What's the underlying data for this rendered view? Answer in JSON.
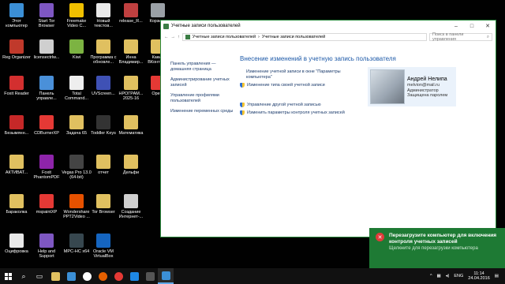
{
  "desktop": {
    "icons": [
      {
        "label": "Этот компьютер",
        "color": "#3b8fd6",
        "icon": "computer-icon"
      },
      {
        "label": "Start Tor Browser",
        "color": "#7e57c2",
        "icon": "tor-icon"
      },
      {
        "label": "Freemake Video C...",
        "color": "#f0c000",
        "icon": "freemake-icon"
      },
      {
        "label": "Новый текстов...",
        "color": "#e8e8e8",
        "icon": "text-file-icon"
      },
      {
        "label": "release_R...",
        "color": "#c04040",
        "icon": "archive-icon"
      },
      {
        "label": "Корзина",
        "color": "#9aa0a6",
        "icon": "recycle-bin-icon"
      },
      {
        "label": "Reg Organizer",
        "color": "#c0392b",
        "icon": "regorganizer-icon"
      },
      {
        "label": "licensectrlw...",
        "color": "#cfcfcf",
        "icon": "file-icon"
      },
      {
        "label": "Kiwi",
        "color": "#7cb342",
        "icon": "kiwi-icon"
      },
      {
        "label": "Программа с обновле...",
        "color": "#e0c060",
        "icon": "folder-icon"
      },
      {
        "label": "Инна Владимир...",
        "color": "#e0c060",
        "icon": "folder-icon"
      },
      {
        "label": "Какие ВКонтак...",
        "color": "#e0c060",
        "icon": "folder-icon"
      },
      {
        "label": "Foxit Reader",
        "color": "#d32f2f",
        "icon": "foxit-icon"
      },
      {
        "label": "Панель управле...",
        "color": "#4a90d9",
        "icon": "control-panel-icon"
      },
      {
        "label": "Total Command...",
        "color": "#eeeeee",
        "icon": "total-commander-icon"
      },
      {
        "label": "UVScreen...",
        "color": "#3f51b5",
        "icon": "uvscreen-icon"
      },
      {
        "label": "НРОГРАМ... 2025-16",
        "color": "#e0c060",
        "icon": "folder-icon"
      },
      {
        "label": "Opera",
        "color": "#e53935",
        "icon": "opera-icon"
      },
      {
        "label": "Безымянн...",
        "color": "#c62828",
        "icon": "image-icon"
      },
      {
        "label": "CDBurnerXP",
        "color": "#e53935",
        "icon": "cdburner-icon"
      },
      {
        "label": "Задача 65",
        "color": "#e0c060",
        "icon": "folder-icon"
      },
      {
        "label": "Toddler Keys",
        "color": "#333333",
        "icon": "toddler-keys-icon"
      },
      {
        "label": "Математика",
        "color": "#e0c060",
        "icon": "folder-icon"
      },
      {
        "label": "АКТИВАТ...",
        "color": "#e0c060",
        "icon": "folder-icon"
      },
      {
        "label": "Foxit PhantomPDF",
        "color": "#8e24aa",
        "icon": "phantompdf-icon"
      },
      {
        "label": "Vegas Pro 13.0 (64-bit)",
        "color": "#444444",
        "icon": "vegas-icon"
      },
      {
        "label": "отчет",
        "color": "#e0c060",
        "icon": "folder-icon"
      },
      {
        "label": "Дельфи",
        "color": "#e0c060",
        "icon": "folder-icon"
      },
      {
        "label": "Бараколка",
        "color": "#e0c060",
        "icon": "folder-icon"
      },
      {
        "label": "mspaintXP",
        "color": "#e53935",
        "icon": "paint-icon"
      },
      {
        "label": "Wondershare PPT2Video ...",
        "color": "#e65100",
        "icon": "wondershare-icon"
      },
      {
        "label": "Tor Browser",
        "color": "#e0c060",
        "icon": "folder-icon"
      },
      {
        "label": "Создание Интернет-...",
        "color": "#cfcfcf",
        "icon": "file-icon"
      },
      {
        "label": "Оцифровка",
        "color": "#e8e8e8",
        "icon": "text-file-icon"
      },
      {
        "label": "Help and Support",
        "color": "#7e57c2",
        "icon": "help-icon"
      },
      {
        "label": "MPC-HC x64",
        "color": "#37474f",
        "icon": "mpc-icon"
      },
      {
        "label": "Oracle VM VirtualBox",
        "color": "#1565c0",
        "icon": "virtualbox-icon"
      }
    ]
  },
  "window": {
    "title": "Учетные записи пользователей",
    "minimize": "–",
    "maximize": "□",
    "close": "✕",
    "breadcrumb": [
      "Учетные записи пользователей",
      "Учетные записи пользователей"
    ],
    "search_placeholder": "Поиск в панели управления",
    "left_links": [
      "Панель управления — домашняя страница",
      "Администрирование учетных записей",
      "Управление профилями пользователей",
      "Изменение переменных среды"
    ],
    "main_title": "Внесение изменений в учетную запись пользователя",
    "links": [
      "Изменение учетной записи в окне \"Параметры компьютера\"",
      "Изменение типа своей учетной записи",
      "Управление другой учетной записью",
      "Изменить параметры контроля учетных записей"
    ],
    "user": {
      "name": "Андрей Нелипа",
      "email": "melvion@mail.ru",
      "role": "Администратор",
      "protection": "Защищена паролем"
    }
  },
  "toast": {
    "title": "Перезагрузите компьютер для включения контроля учетных записей",
    "subtitle": "Щелкните для перезагрузки компьютера"
  },
  "taskbar": {
    "lang": "ENG",
    "time": "11:14",
    "date": "24.04.2016"
  }
}
